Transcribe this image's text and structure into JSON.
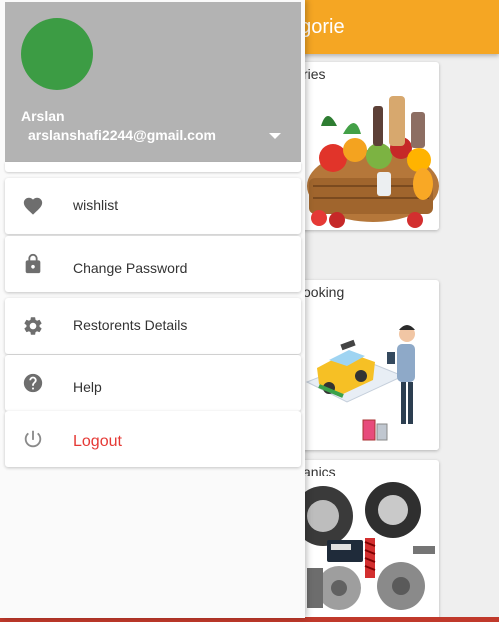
{
  "app_bar": {
    "title": "egorie"
  },
  "categories": [
    {
      "label": "ries"
    },
    {
      "label": "ooking"
    },
    {
      "label": "anics"
    }
  ],
  "drawer": {
    "account": {
      "name": "Arslan",
      "email": "arslanshafi2244@gmail.com"
    },
    "menu": [
      {
        "label": "wishlist",
        "icon": "heart-icon"
      },
      {
        "label": "Change Password",
        "icon": "lock-icon"
      },
      {
        "label": "Restorents Details",
        "icon": "gear-icon"
      },
      {
        "label": "Help",
        "icon": "help-circle-icon"
      },
      {
        "label": "Logout",
        "icon": "power-icon"
      }
    ]
  },
  "colors": {
    "app_bar": "#f5a623",
    "header_bg": "#b3b3b3",
    "avatar": "#3c9c44",
    "icon": "#6e6e6e",
    "logout": "#e53935"
  }
}
